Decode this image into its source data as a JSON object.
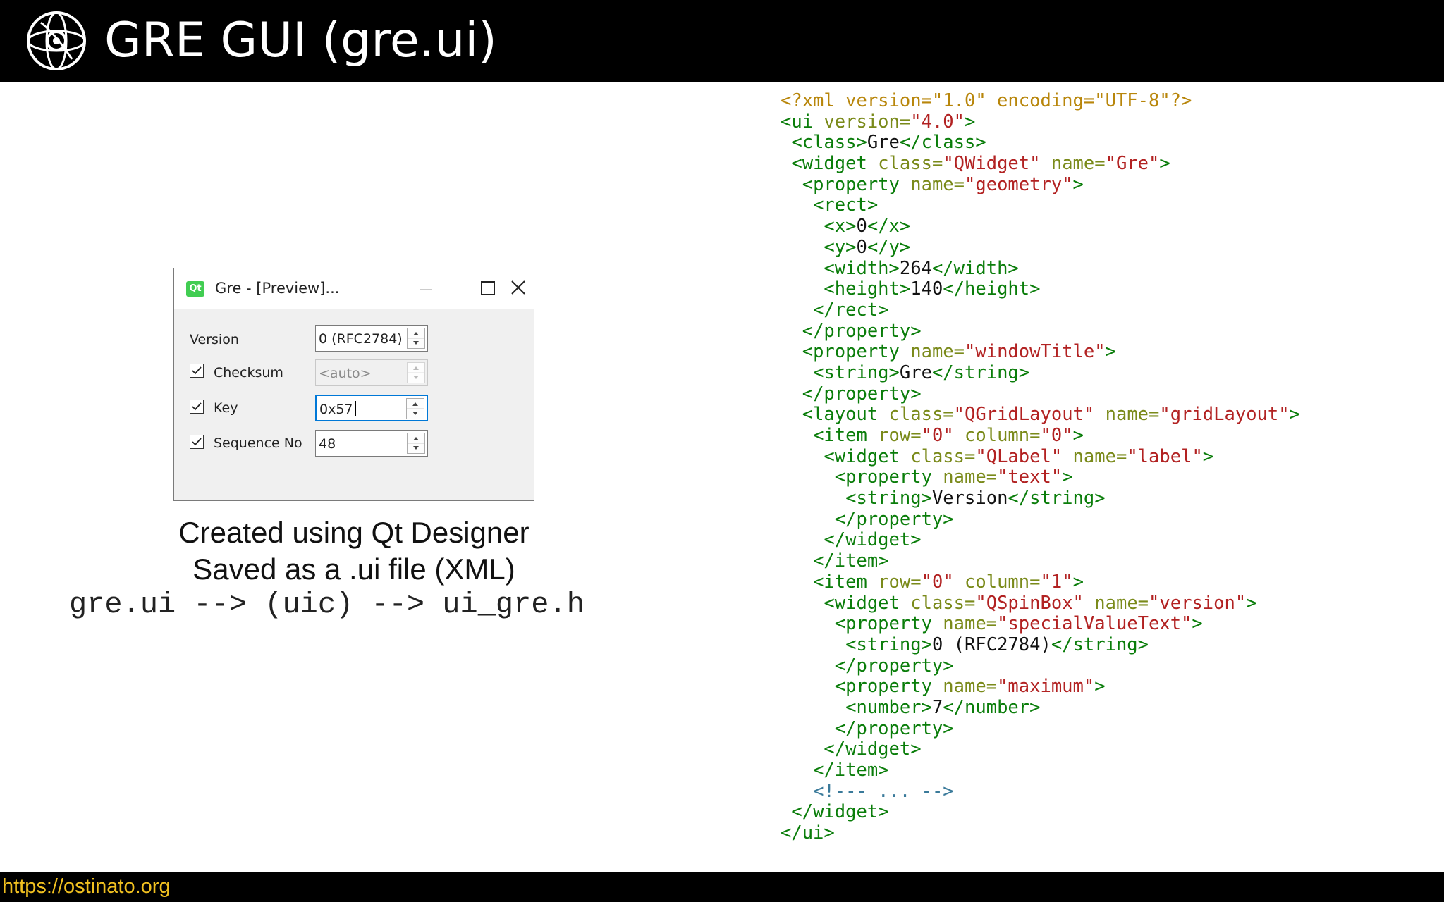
{
  "header": {
    "title": "GRE GUI (gre.ui)",
    "logo_icon": "ostinato-logo-icon"
  },
  "preview_window": {
    "title": "Gre - [Preview]...",
    "app_icon": "qt-icon",
    "app_icon_text": "Qt",
    "rows": [
      {
        "label": "Version",
        "value": "0 (RFC2784)",
        "checkbox": false
      },
      {
        "label": "Checksum",
        "value": "<auto>",
        "checkbox": true,
        "checked": true,
        "enabled": false
      },
      {
        "label": "Key",
        "value": "0x57",
        "checkbox": true,
        "checked": true,
        "focused": true
      },
      {
        "label": "Sequence No",
        "value": "48",
        "checkbox": true,
        "checked": true
      }
    ]
  },
  "captions": {
    "line1": "Created using Qt Designer",
    "line2": "Saved as a .ui file (XML)",
    "command": "gre.ui --> (uic) --> ui_gre.h"
  },
  "code": {
    "lines": [
      [
        [
          "pi",
          "<?xml version=\"1.0\" encoding=\"UTF-8\"?>"
        ]
      ],
      [
        [
          "tag",
          "<ui "
        ],
        [
          "attr",
          "version="
        ],
        [
          "val",
          "\"4.0\""
        ],
        [
          "tag",
          ">"
        ]
      ],
      [
        [
          "text",
          " "
        ],
        [
          "tag",
          "<class>"
        ],
        [
          "text",
          "Gre"
        ],
        [
          "tag",
          "</class>"
        ]
      ],
      [
        [
          "text",
          " "
        ],
        [
          "tag",
          "<widget "
        ],
        [
          "attr",
          "class="
        ],
        [
          "val",
          "\"QWidget\""
        ],
        [
          "attr",
          " name="
        ],
        [
          "val",
          "\"Gre\""
        ],
        [
          "tag",
          ">"
        ]
      ],
      [
        [
          "text",
          "  "
        ],
        [
          "tag",
          "<property "
        ],
        [
          "attr",
          "name="
        ],
        [
          "val",
          "\"geometry\""
        ],
        [
          "tag",
          ">"
        ]
      ],
      [
        [
          "text",
          "   "
        ],
        [
          "tag",
          "<rect>"
        ]
      ],
      [
        [
          "text",
          "    "
        ],
        [
          "tag",
          "<x>"
        ],
        [
          "text",
          "0"
        ],
        [
          "tag",
          "</x>"
        ]
      ],
      [
        [
          "text",
          "    "
        ],
        [
          "tag",
          "<y>"
        ],
        [
          "text",
          "0"
        ],
        [
          "tag",
          "</y>"
        ]
      ],
      [
        [
          "text",
          "    "
        ],
        [
          "tag",
          "<width>"
        ],
        [
          "text",
          "264"
        ],
        [
          "tag",
          "</width>"
        ]
      ],
      [
        [
          "text",
          "    "
        ],
        [
          "tag",
          "<height>"
        ],
        [
          "text",
          "140"
        ],
        [
          "tag",
          "</height>"
        ]
      ],
      [
        [
          "text",
          "   "
        ],
        [
          "tag",
          "</rect>"
        ]
      ],
      [
        [
          "text",
          "  "
        ],
        [
          "tag",
          "</property>"
        ]
      ],
      [
        [
          "text",
          "  "
        ],
        [
          "tag",
          "<property "
        ],
        [
          "attr",
          "name="
        ],
        [
          "val",
          "\"windowTitle\""
        ],
        [
          "tag",
          ">"
        ]
      ],
      [
        [
          "text",
          "   "
        ],
        [
          "tag",
          "<string>"
        ],
        [
          "text",
          "Gre"
        ],
        [
          "tag",
          "</string>"
        ]
      ],
      [
        [
          "text",
          "  "
        ],
        [
          "tag",
          "</property>"
        ]
      ],
      [
        [
          "text",
          "  "
        ],
        [
          "tag",
          "<layout "
        ],
        [
          "attr",
          "class="
        ],
        [
          "val",
          "\"QGridLayout\""
        ],
        [
          "attr",
          " name="
        ],
        [
          "val",
          "\"gridLayout\""
        ],
        [
          "tag",
          ">"
        ]
      ],
      [
        [
          "text",
          "   "
        ],
        [
          "tag",
          "<item "
        ],
        [
          "attr",
          "row="
        ],
        [
          "val",
          "\"0\""
        ],
        [
          "attr",
          " column="
        ],
        [
          "val",
          "\"0\""
        ],
        [
          "tag",
          ">"
        ]
      ],
      [
        [
          "text",
          "    "
        ],
        [
          "tag",
          "<widget "
        ],
        [
          "attr",
          "class="
        ],
        [
          "val",
          "\"QLabel\""
        ],
        [
          "attr",
          " name="
        ],
        [
          "val",
          "\"label\""
        ],
        [
          "tag",
          ">"
        ]
      ],
      [
        [
          "text",
          "     "
        ],
        [
          "tag",
          "<property "
        ],
        [
          "attr",
          "name="
        ],
        [
          "val",
          "\"text\""
        ],
        [
          "tag",
          ">"
        ]
      ],
      [
        [
          "text",
          "      "
        ],
        [
          "tag",
          "<string>"
        ],
        [
          "text",
          "Version"
        ],
        [
          "tag",
          "</string>"
        ]
      ],
      [
        [
          "text",
          "     "
        ],
        [
          "tag",
          "</property>"
        ]
      ],
      [
        [
          "text",
          "    "
        ],
        [
          "tag",
          "</widget>"
        ]
      ],
      [
        [
          "text",
          "   "
        ],
        [
          "tag",
          "</item>"
        ]
      ],
      [
        [
          "text",
          "   "
        ],
        [
          "tag",
          "<item "
        ],
        [
          "attr",
          "row="
        ],
        [
          "val",
          "\"0\""
        ],
        [
          "attr",
          " column="
        ],
        [
          "val",
          "\"1\""
        ],
        [
          "tag",
          ">"
        ]
      ],
      [
        [
          "text",
          "    "
        ],
        [
          "tag",
          "<widget "
        ],
        [
          "attr",
          "class="
        ],
        [
          "val",
          "\"QSpinBox\""
        ],
        [
          "attr",
          " name="
        ],
        [
          "val",
          "\"version\""
        ],
        [
          "tag",
          ">"
        ]
      ],
      [
        [
          "text",
          "     "
        ],
        [
          "tag",
          "<property "
        ],
        [
          "attr",
          "name="
        ],
        [
          "val",
          "\"specialValueText\""
        ],
        [
          "tag",
          ">"
        ]
      ],
      [
        [
          "text",
          "      "
        ],
        [
          "tag",
          "<string>"
        ],
        [
          "text",
          "0 (RFC2784)"
        ],
        [
          "tag",
          "</string>"
        ]
      ],
      [
        [
          "text",
          "     "
        ],
        [
          "tag",
          "</property>"
        ]
      ],
      [
        [
          "text",
          "     "
        ],
        [
          "tag",
          "<property "
        ],
        [
          "attr",
          "name="
        ],
        [
          "val",
          "\"maximum\""
        ],
        [
          "tag",
          ">"
        ]
      ],
      [
        [
          "text",
          "      "
        ],
        [
          "tag",
          "<number>"
        ],
        [
          "text",
          "7"
        ],
        [
          "tag",
          "</number>"
        ]
      ],
      [
        [
          "text",
          "     "
        ],
        [
          "tag",
          "</property>"
        ]
      ],
      [
        [
          "text",
          "    "
        ],
        [
          "tag",
          "</widget>"
        ]
      ],
      [
        [
          "text",
          "   "
        ],
        [
          "tag",
          "</item>"
        ]
      ],
      [
        [
          "text",
          "   "
        ],
        [
          "comment",
          "<!--- ... -->"
        ]
      ],
      [
        [
          "text",
          " "
        ],
        [
          "tag",
          "</widget>"
        ]
      ],
      [
        [
          "tag",
          "</ui>"
        ]
      ]
    ]
  },
  "footer": {
    "link": "https://ostinato.org"
  },
  "colors": {
    "header_bg": "#000000",
    "footer_link": "#f0c020",
    "xml_tag": "#0a7d0a",
    "xml_attr": "#7a8a1a",
    "xml_value": "#b22222",
    "xml_pi": "#b8860b"
  }
}
